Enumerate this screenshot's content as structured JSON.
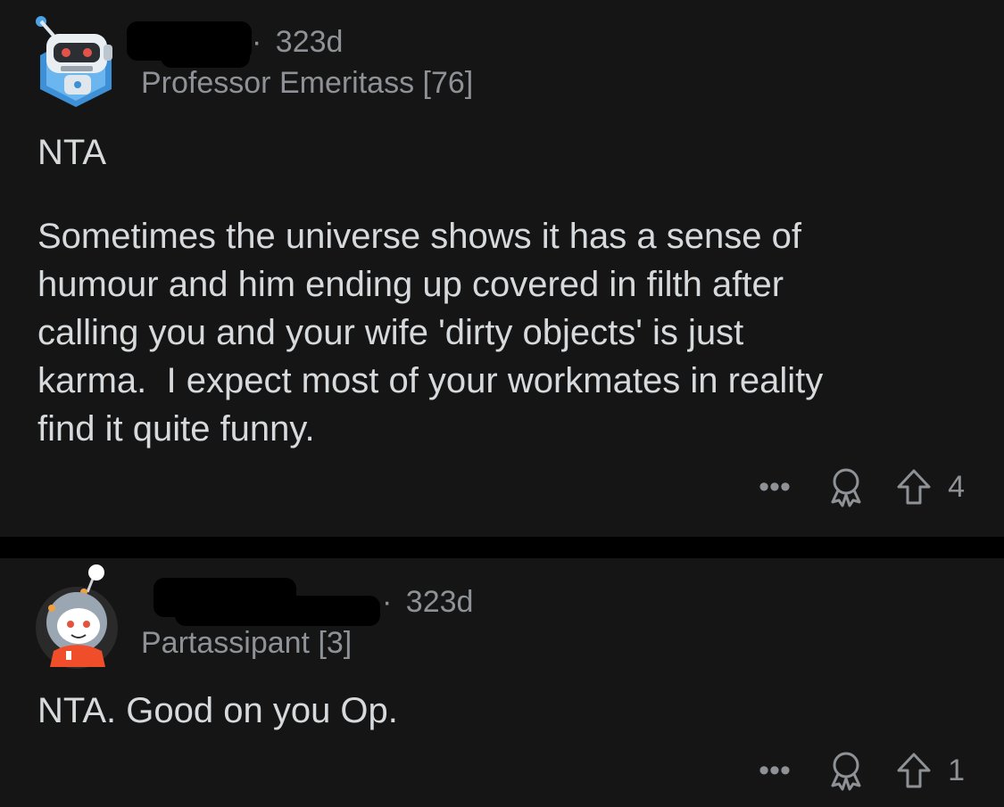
{
  "comments": [
    {
      "age": "323d",
      "flair": "Professor Emeritass [76]",
      "body_title": "NTA",
      "body": "Sometimes the universe shows it has a sense of\nhumour and him ending up covered in filth after\ncalling you and your wife 'dirty objects' is just\nkarma.  I expect most of your workmates in reality\nfind it quite funny.",
      "votes": "4",
      "avatar_icon": "robot-avatar-icon"
    },
    {
      "age": "323d",
      "flair": "Partassipant [3]",
      "body": "NTA. Good on you Op.",
      "votes": "1",
      "avatar_icon": "snoo-astronaut-avatar-icon"
    }
  ],
  "separator": "·",
  "icons": {
    "more": "more-options-icon",
    "award": "award-icon",
    "upvote": "upvote-arrow-icon"
  },
  "colors": {
    "background": "#151515",
    "text": "#d7dadc",
    "muted": "#8e9296"
  }
}
